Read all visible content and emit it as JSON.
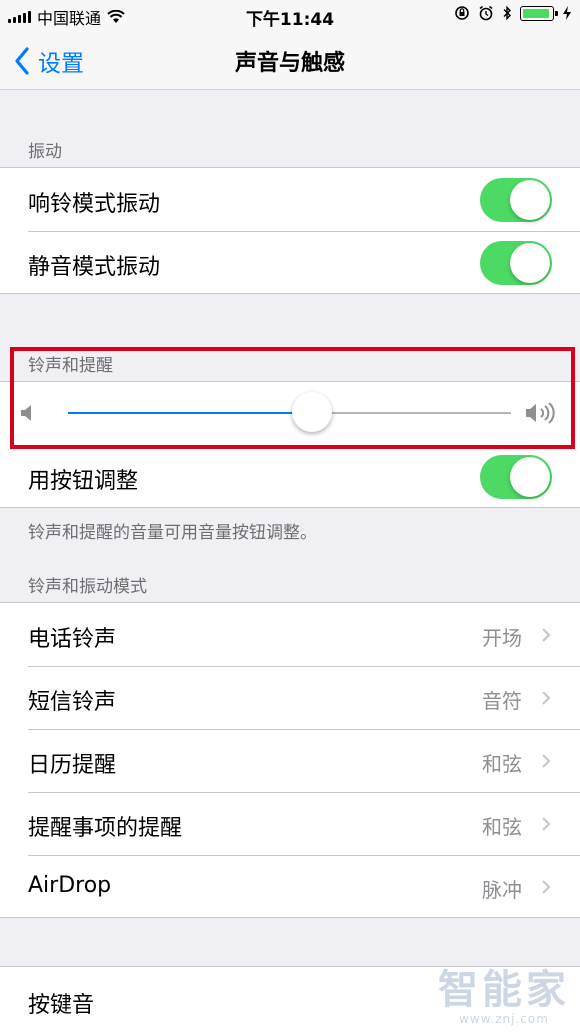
{
  "status_bar": {
    "carrier": "中国联通",
    "time": "下午11:44"
  },
  "nav": {
    "back_label": "设置",
    "title": "声音与触感"
  },
  "vibration": {
    "header": "振动",
    "rows": [
      {
        "label": "响铃模式振动",
        "on": true
      },
      {
        "label": "静音模式振动",
        "on": true
      }
    ]
  },
  "ringer": {
    "header": "铃声和提醒",
    "volume_fraction": 0.55,
    "adjust_label": "用按钮调整",
    "adjust_on": true,
    "footer": "铃声和提醒的音量可用音量按钮调整。"
  },
  "patterns": {
    "header": "铃声和振动模式",
    "rows": [
      {
        "label": "电话铃声",
        "value": "开场"
      },
      {
        "label": "短信铃声",
        "value": "音符"
      },
      {
        "label": "日历提醒",
        "value": "和弦"
      },
      {
        "label": "提醒事项的提醒",
        "value": "和弦"
      },
      {
        "label": "AirDrop",
        "value": "脉冲"
      }
    ]
  },
  "keyboard": {
    "label": "按键音"
  },
  "watermark": {
    "text": "智能家",
    "url": "www.znj.com"
  },
  "colors": {
    "accent": "#007aff",
    "toggle_on": "#4cd964",
    "highlight": "#d9001b"
  }
}
